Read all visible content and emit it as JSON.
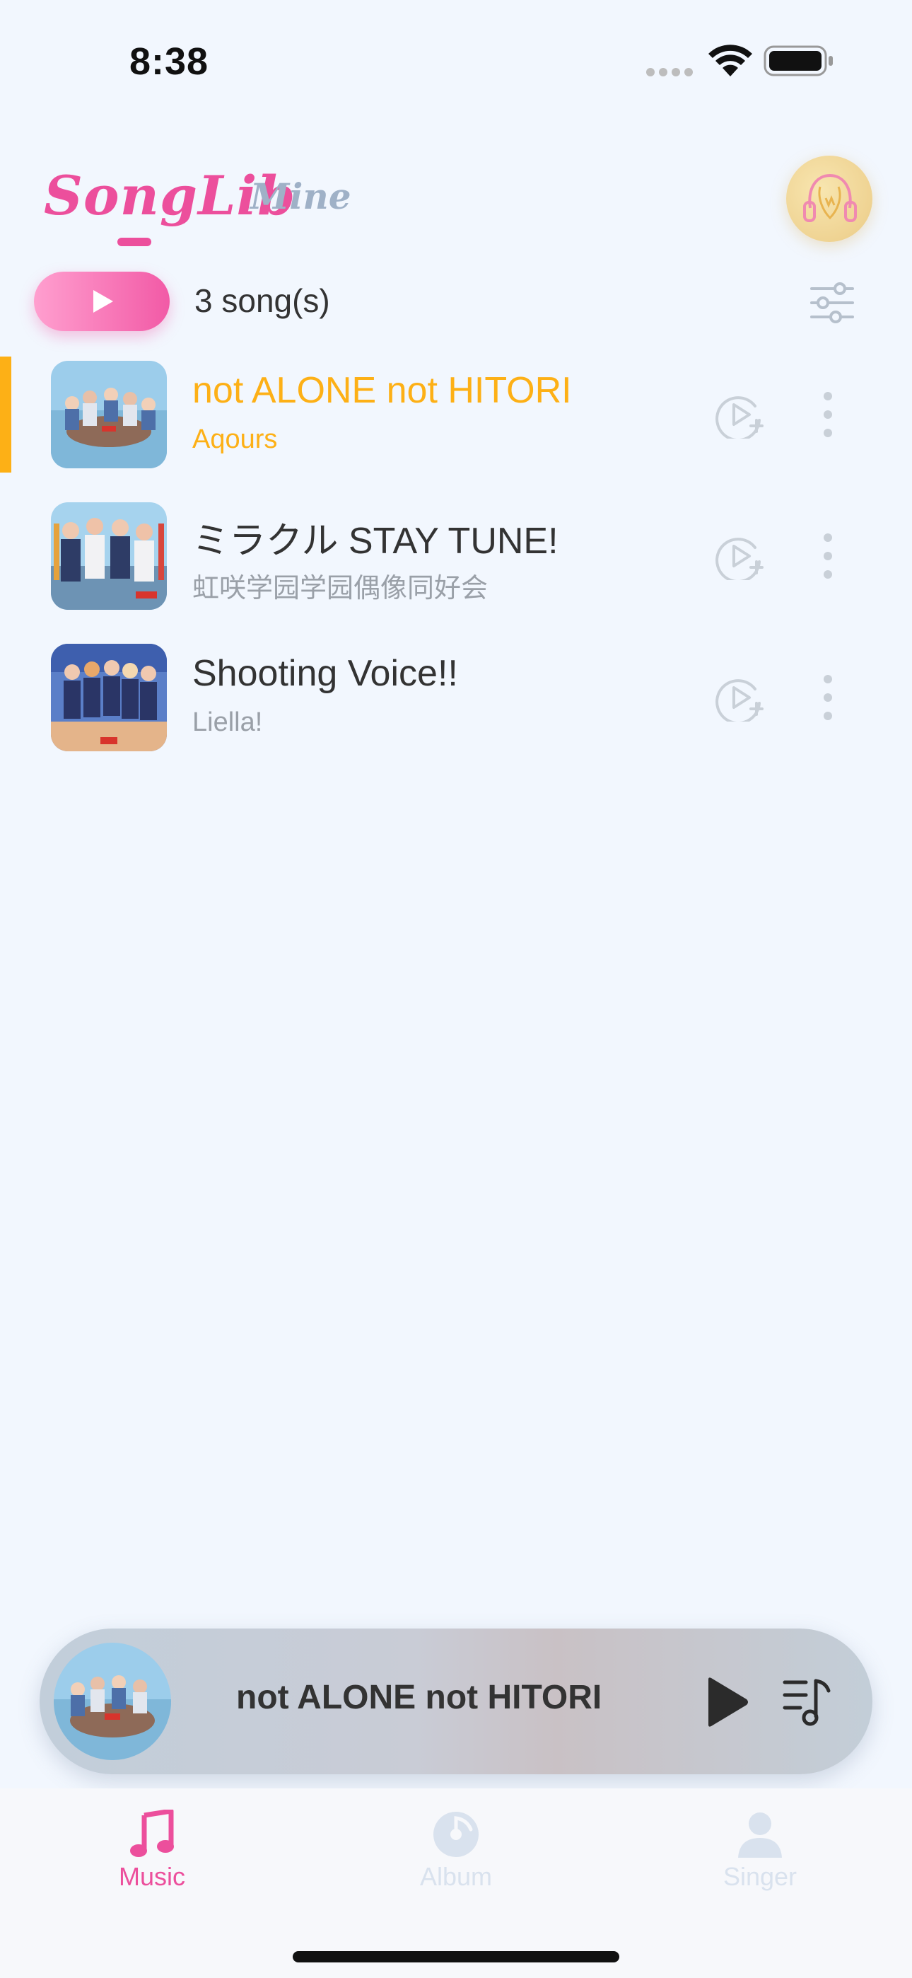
{
  "status_bar": {
    "time": "8:38"
  },
  "header": {
    "brand": "SongLib",
    "tab_mine": "Mine"
  },
  "playlist_bar": {
    "song_count": "3 song(s)"
  },
  "songs": [
    {
      "title": "not ALONE not HITORI",
      "artist": "Aqours",
      "playing": true
    },
    {
      "title": "ミラクル STAY TUNE!",
      "artist": "虹咲学园学园偶像同好会",
      "playing": false
    },
    {
      "title": "Shooting Voice!!",
      "artist": "Liella!",
      "playing": false
    }
  ],
  "mini_player": {
    "title": "not ALONE not HITORI"
  },
  "bottom_nav": {
    "items": [
      {
        "label": "Music",
        "active": true
      },
      {
        "label": "Album",
        "active": false
      },
      {
        "label": "Singer",
        "active": false
      }
    ]
  },
  "colors": {
    "accent_pink": "#EC4F9C",
    "playing_gold": "#FDB016",
    "background": "#F2F7FE"
  }
}
